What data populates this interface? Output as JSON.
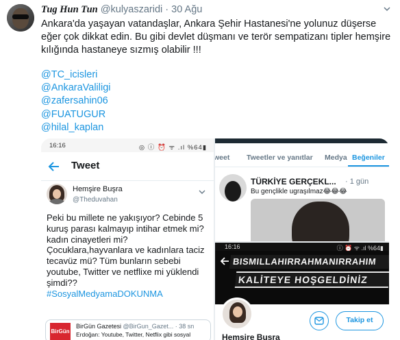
{
  "tweet": {
    "author_name": "Tug Hun Tun",
    "author_handle": "@kulyaszaridi",
    "separator": "·",
    "date": "30 Ağu",
    "body": "Ankara'da yaşayan vatandaşlar, Ankara Şehir Hastanesi'ne yolunuz düşerse eğer çok dikkat edin. Bu gibi devlet düşmanı ve terör sempatizanı tipler hemşire kılığında hastaneye sızmış olabilir !!!",
    "mentions": [
      "@TC_icisleri",
      "@AnkaraValiligi",
      "@zafersahin06",
      "@FUATUGUR",
      "@hilal_kaplan"
    ],
    "icons": {
      "menu": "chevron-down-icon",
      "avatar": "avatar"
    }
  },
  "media": {
    "left_shot": {
      "status_time": "16:16",
      "status_icons": "◎ ⓘ ⏰ ᯤ .ıl %64▮",
      "header_title": "Tweet",
      "quoted_name": "Hemşire Buşra",
      "quoted_handle": "@Theduvahan",
      "quoted_text": "Peki bu millete ne yakışıyor? Cebinde 5 kuruş parası kalmayıp intihar etmek mi? kadın cinayetleri mi? Çocuklara,hayvanlara ve kadınlara taciz tecavüz mü? Tüm bunların sebebi youtube, Twitter ve netflixe mi yüklendi şimdi??",
      "quoted_hashtag": "#SosyalMedyamaDOKUNMA",
      "embed_logo": "BirGün",
      "embed_name": "BirGün Gazetesi",
      "embed_sub": "@BirGun_Gazet... · 38 sn",
      "embed_text": "Erdoğan: Youtube, Twitter, Netflix gibi sosyal"
    },
    "right_top_shot": {
      "tabs": [
        "weet",
        "Tweetler ve yanıtlar",
        "Medya",
        "Beğeniler"
      ],
      "active_tab": "Beğeniler",
      "name": "TÜRKİYE GERÇEKL...",
      "time": "· 1 gün",
      "text": "Bu gençlikle ugraşılmaz😂😂😂"
    },
    "right_bottom_shot": {
      "status_time": "16:16",
      "status_icons": "ⓘ ⏰ ᯤ .ıl %64▮",
      "banner_line1": "BISMILLAHIRRAHMANIRRAHIM",
      "banner_line2": "KALİTEYE HOŞGELDİNİZ",
      "follow_label": "Takip et",
      "name": "Hemşire Buşra"
    }
  },
  "colors": {
    "link": "#1b95e0",
    "text": "#14171a",
    "muted": "#657786"
  }
}
